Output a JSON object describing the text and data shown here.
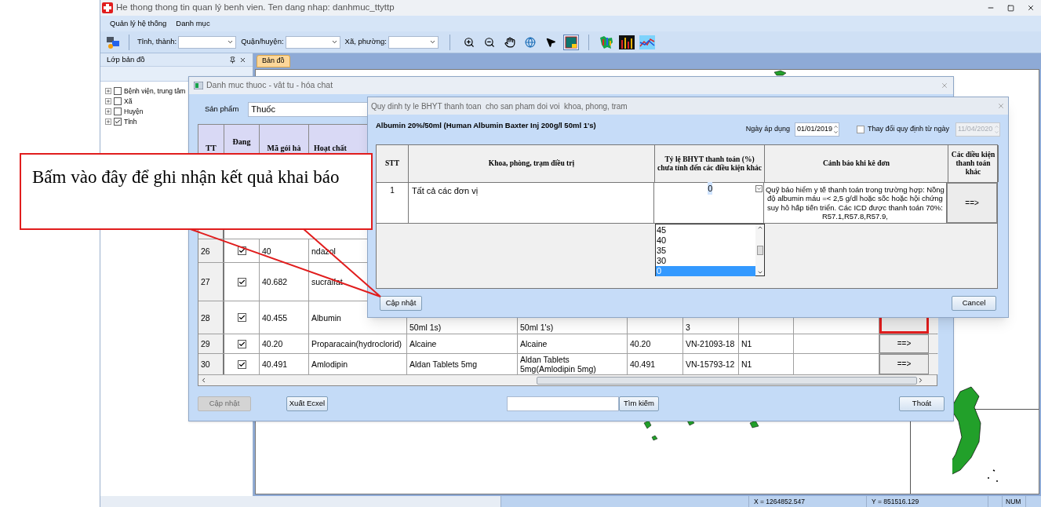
{
  "window": {
    "title": "He thong thong tin quan lý benh vien. Ten dang nhap: danhmuc_ttyttp",
    "menu": [
      "Quản lý hệ thống",
      "Danh mục"
    ]
  },
  "toolbar": {
    "filters": [
      {
        "label": "Tỉnh, thành:"
      },
      {
        "label": "Quận/huyện:"
      },
      {
        "label": "Xã, phường:"
      }
    ],
    "tools": [
      {
        "kind": "zoom_in",
        "selected": false
      },
      {
        "kind": "zoom_out",
        "selected": false
      },
      {
        "kind": "pan",
        "selected": false
      },
      {
        "kind": "globe",
        "selected": false
      },
      {
        "kind": "pointer",
        "selected": false
      },
      {
        "kind": "layer",
        "selected": true
      }
    ],
    "charts": [
      {
        "kind": "map_chart"
      },
      {
        "kind": "bar_chart"
      },
      {
        "kind": "line_chart"
      }
    ]
  },
  "layer_panel": {
    "title": "Lớp bản đồ",
    "layers": [
      {
        "label": "Bệnh viện, trung tâm",
        "checked": false
      },
      {
        "label": "Xã",
        "checked": false
      },
      {
        "label": "Huyện",
        "checked": false
      },
      {
        "label": "Tỉnh",
        "checked": true
      }
    ]
  },
  "map_tab": {
    "label": "Bản đồ"
  },
  "catalog_dialog": {
    "title": "Danh muc thuoc - vât tu - hóa chat",
    "product_label": "Sản phẩm",
    "product_value": "Thuốc",
    "columns": [
      "TT",
      "Đang",
      "Mã gói hà",
      "Hoạt chất"
    ],
    "rows": [
      {
        "tt": "26",
        "in_use": true,
        "code": "40",
        "ingredient": "ndazol",
        "highlighted": false
      },
      {
        "tt": "27",
        "in_use": true,
        "code": "40.682",
        "ingredient": "sucralfat",
        "highlighted": false
      },
      {
        "tt": "28",
        "in_use": true,
        "code": "40.455",
        "ingredient": "Albumin",
        "name": "50ml 1s)",
        "full_name": "50ml 1's)",
        "reg_no": "3",
        "highlighted": true
      },
      {
        "tt": "29",
        "in_use": true,
        "code": "40.20",
        "ingredient": "Proparacain(hydroclorid)",
        "name": "Alcaine",
        "full_name": "Alcaine",
        "code_2": "40.20",
        "reg_no": "VN-21093-18",
        "group": "N1",
        "highlighted": false,
        "action": "==>"
      },
      {
        "tt": "30",
        "in_use": true,
        "code": "40.491",
        "ingredient": "Amlodipin",
        "name": "Aldan Tablets 5mg",
        "full_name": "Aldan Tablets 5mg(Amlodipin 5mg)",
        "code_2": "40.491",
        "reg_no": "VN-15793-12",
        "group": "N1",
        "highlighted": false,
        "action": "==>"
      }
    ],
    "update_button": {
      "label": "Cập nhật",
      "disabled": true
    },
    "export_button": "Xuất Ecxel",
    "search_button": "Tìm kiếm",
    "exit_button": "Thoát"
  },
  "rate_dialog": {
    "title": "Quy dinh ty le BHYT thanh toan  cho san pham doi voi  khoa, phong, tram",
    "product": "Albumin 20%/50ml (Human Albumin Baxter Inj 200g/l 50ml 1's)",
    "apply_date_label": "Ngày áp dụng",
    "apply_date": "01/01/2019",
    "change_label": "Thay đổi quy định từ ngày",
    "change_checked": false,
    "change_date": "11/04/2020",
    "change_date_disabled": true,
    "columns": [
      "STT",
      "Khoa, phòng, trạm điều trị",
      "Tỷ lệ BHYT thanh toán (%) chưa tính đến các điều kiện khác",
      "Cảnh báo khi kê đơn",
      "Các điều kiện thanh toán khác"
    ],
    "rows": [
      {
        "stt": "1",
        "unit": "Tất cả các đơn vị",
        "rate": "0",
        "warning": "Quỹ bảo hiểm y tế thanh toán trong trường hợp: Nồng độ albumin máu =< 2,5 g/dl hoặc sốc hoặc hội chứng suy hô hấp tiến triển. Các ICD được thanh toán 70%: R57.1,R57.8,R57.9,",
        "action": "==>"
      }
    ],
    "rate_options": [
      {
        "label": "45",
        "selected": false
      },
      {
        "label": "40",
        "selected": false
      },
      {
        "label": "35",
        "selected": false
      },
      {
        "label": "30",
        "selected": false
      },
      {
        "label": "0",
        "selected": true
      }
    ],
    "update_button": "Cập nhật",
    "cancel_button": "Cancel"
  },
  "callout": {
    "text": "Bấm vào đây để ghi nhận kết quả khai báo"
  },
  "status_bar": {
    "x_coord": "X = 1264852.547",
    "y_coord": "Y = 851516.129",
    "mode": "NUM"
  }
}
